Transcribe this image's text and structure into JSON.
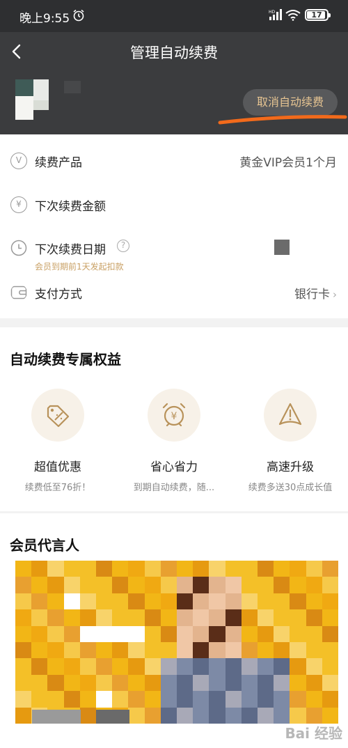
{
  "status_bar": {
    "time": "晚上9:55",
    "signal_label": "HD",
    "battery": "17"
  },
  "header": {
    "title": "管理自动续费",
    "cancel_button": "取消自动续费"
  },
  "info": {
    "product_label": "续费产品",
    "product_value": "黄金VIP会员1个月",
    "amount_label": "下次续费金额",
    "date_label": "下次续费日期",
    "date_note": "会员到期前1天发起扣款",
    "payment_label": "支付方式",
    "payment_value": "银行卡",
    "icons": [
      "vip-v-icon",
      "yuan-icon",
      "clock-icon",
      "help-icon",
      "wallet-icon",
      "chevron-right-icon"
    ]
  },
  "benefits": {
    "title": "自动续费专属权益",
    "items": [
      {
        "title": "超值优惠",
        "desc": "续费低至76折！",
        "icon": "discount-tag-icon"
      },
      {
        "title": "省心省力",
        "desc": "到期自动续费，随...",
        "icon": "alarm-yuan-icon"
      },
      {
        "title": "高速升级",
        "desc": "续费多送30点成长值",
        "icon": "speed-upgrade-icon"
      }
    ]
  },
  "spokesperson": {
    "title": "会员代言人"
  },
  "colors": {
    "header_bg": "#3b3c3e",
    "gold_text": "#e7c592",
    "highlight_stroke": "#f26a1b",
    "icon_gold": "#b8925a"
  }
}
